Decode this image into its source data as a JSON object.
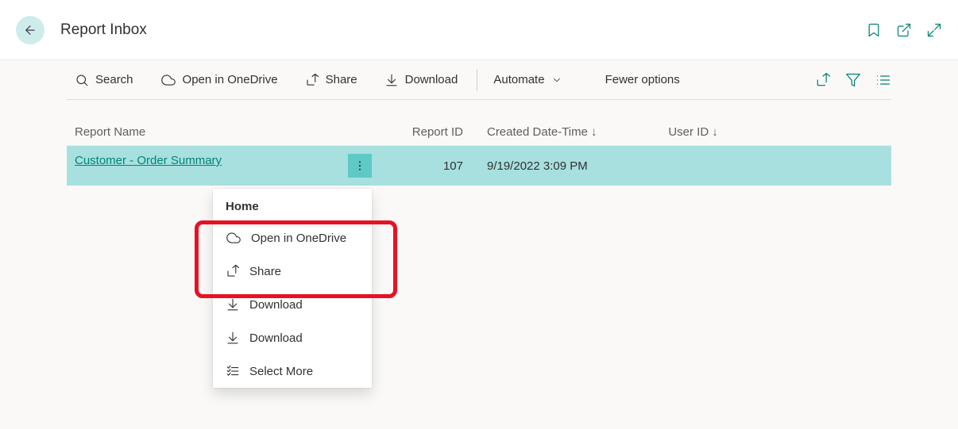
{
  "header": {
    "title": "Report Inbox"
  },
  "toolbar": {
    "search": "Search",
    "open_onedrive": "Open in OneDrive",
    "share": "Share",
    "download": "Download",
    "automate": "Automate",
    "fewer_options": "Fewer options"
  },
  "columns": {
    "report_name": "Report Name",
    "report_id": "Report ID",
    "created": "Created Date-Time",
    "user_id": "User ID"
  },
  "row": {
    "name": "Customer - Order Summary",
    "id": "107",
    "created": "9/19/2022 3:09 PM",
    "user_id": ""
  },
  "context_menu": {
    "header": "Home",
    "open_onedrive": "Open in OneDrive",
    "share": "Share",
    "download1": "Download",
    "download2": "Download",
    "select_more": "Select More"
  }
}
